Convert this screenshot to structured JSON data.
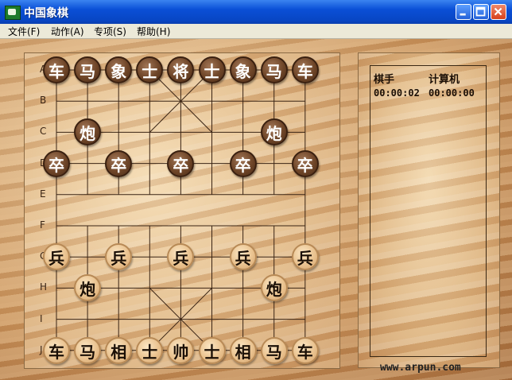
{
  "window": {
    "title": "中国象棋"
  },
  "menu": [
    "文件(F)",
    "动作(A)",
    "专项(S)",
    "帮助(H)"
  ],
  "row_labels": [
    "A",
    "B",
    "C",
    "D",
    "E",
    "F",
    "G",
    "H",
    "I",
    "J"
  ],
  "pieces": [
    {
      "ch": "车",
      "side": "black",
      "col": 0,
      "row": 0
    },
    {
      "ch": "马",
      "side": "black",
      "col": 1,
      "row": 0
    },
    {
      "ch": "象",
      "side": "black",
      "col": 2,
      "row": 0
    },
    {
      "ch": "士",
      "side": "black",
      "col": 3,
      "row": 0
    },
    {
      "ch": "将",
      "side": "black",
      "col": 4,
      "row": 0
    },
    {
      "ch": "士",
      "side": "black",
      "col": 5,
      "row": 0
    },
    {
      "ch": "象",
      "side": "black",
      "col": 6,
      "row": 0
    },
    {
      "ch": "马",
      "side": "black",
      "col": 7,
      "row": 0
    },
    {
      "ch": "车",
      "side": "black",
      "col": 8,
      "row": 0
    },
    {
      "ch": "炮",
      "side": "black",
      "col": 1,
      "row": 2
    },
    {
      "ch": "炮",
      "side": "black",
      "col": 7,
      "row": 2
    },
    {
      "ch": "卒",
      "side": "black",
      "col": 0,
      "row": 3
    },
    {
      "ch": "卒",
      "side": "black",
      "col": 2,
      "row": 3
    },
    {
      "ch": "卒",
      "side": "black",
      "col": 4,
      "row": 3
    },
    {
      "ch": "卒",
      "side": "black",
      "col": 6,
      "row": 3
    },
    {
      "ch": "卒",
      "side": "black",
      "col": 8,
      "row": 3
    },
    {
      "ch": "兵",
      "side": "red",
      "col": 0,
      "row": 6
    },
    {
      "ch": "兵",
      "side": "red",
      "col": 2,
      "row": 6
    },
    {
      "ch": "兵",
      "side": "red",
      "col": 4,
      "row": 6
    },
    {
      "ch": "兵",
      "side": "red",
      "col": 6,
      "row": 6
    },
    {
      "ch": "兵",
      "side": "red",
      "col": 8,
      "row": 6
    },
    {
      "ch": "炮",
      "side": "red",
      "col": 1,
      "row": 7
    },
    {
      "ch": "炮",
      "side": "red",
      "col": 7,
      "row": 7
    },
    {
      "ch": "车",
      "side": "red",
      "col": 0,
      "row": 9
    },
    {
      "ch": "马",
      "side": "red",
      "col": 1,
      "row": 9
    },
    {
      "ch": "相",
      "side": "red",
      "col": 2,
      "row": 9
    },
    {
      "ch": "士",
      "side": "red",
      "col": 3,
      "row": 9
    },
    {
      "ch": "帅",
      "side": "red",
      "col": 4,
      "row": 9
    },
    {
      "ch": "士",
      "side": "red",
      "col": 5,
      "row": 9
    },
    {
      "ch": "相",
      "side": "red",
      "col": 6,
      "row": 9
    },
    {
      "ch": "马",
      "side": "red",
      "col": 7,
      "row": 9
    },
    {
      "ch": "车",
      "side": "red",
      "col": 8,
      "row": 9
    }
  ],
  "panel": {
    "player_label": "棋手",
    "computer_label": "计算机",
    "player_time": "00:00:02",
    "computer_time": "00:00:00"
  },
  "watermark": "www.arpun.com",
  "icons": {
    "minimize": "minimize-icon",
    "maximize": "maximize-icon",
    "close": "close-icon",
    "app": "app-icon"
  }
}
